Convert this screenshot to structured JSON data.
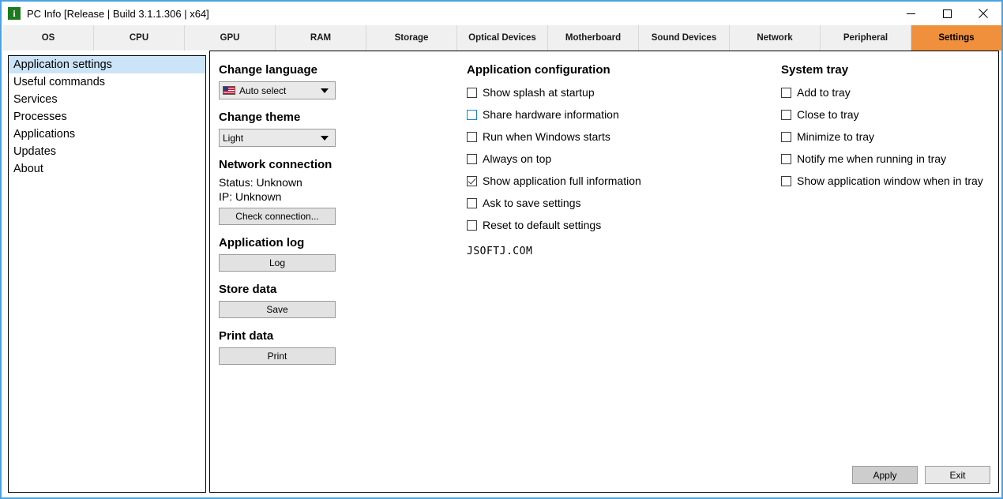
{
  "window": {
    "title": "PC Info [Release | Build 3.1.1.306 | x64]",
    "icon": "info-icon",
    "accent_color": "#f0903c",
    "border_color": "#4aa3e0",
    "controls": {
      "minimize": "minimize-icon",
      "maximize": "maximize-icon",
      "close": "close-icon"
    }
  },
  "tabs": [
    {
      "label": "OS",
      "active": false
    },
    {
      "label": "CPU",
      "active": false
    },
    {
      "label": "GPU",
      "active": false
    },
    {
      "label": "RAM",
      "active": false
    },
    {
      "label": "Storage",
      "active": false
    },
    {
      "label": "Optical Devices",
      "active": false
    },
    {
      "label": "Motherboard",
      "active": false
    },
    {
      "label": "Sound Devices",
      "active": false
    },
    {
      "label": "Network",
      "active": false
    },
    {
      "label": "Peripheral",
      "active": false
    },
    {
      "label": "Settings",
      "active": true
    }
  ],
  "sidebar": {
    "items": [
      {
        "label": "Application settings",
        "selected": true
      },
      {
        "label": "Useful commands",
        "selected": false
      },
      {
        "label": "Services",
        "selected": false
      },
      {
        "label": "Processes",
        "selected": false
      },
      {
        "label": "Applications",
        "selected": false
      },
      {
        "label": "Updates",
        "selected": false
      },
      {
        "label": "About",
        "selected": false
      }
    ]
  },
  "left_column": {
    "language": {
      "heading": "Change language",
      "value": "Auto select",
      "icon": "us-flag-icon"
    },
    "theme": {
      "heading": "Change theme",
      "value": "Light"
    },
    "network": {
      "heading": "Network connection",
      "status": "Status: Unknown",
      "ip": "IP: Unknown",
      "check_button": "Check connection..."
    },
    "app_log": {
      "heading": "Application log",
      "button": "Log"
    },
    "store_data": {
      "heading": "Store data",
      "button": "Save"
    },
    "print_data": {
      "heading": "Print data",
      "button": "Print"
    }
  },
  "app_config": {
    "heading": "Application configuration",
    "options": [
      {
        "label": "Show splash at startup",
        "checked": false,
        "focused": false
      },
      {
        "label": "Share hardware information",
        "checked": false,
        "focused": true
      },
      {
        "label": "Run when Windows starts",
        "checked": false,
        "focused": false
      },
      {
        "label": "Always on top",
        "checked": false,
        "focused": false
      },
      {
        "label": "Show application full information",
        "checked": true,
        "focused": false
      },
      {
        "label": "Ask to save settings",
        "checked": false,
        "focused": false
      },
      {
        "label": "Reset to default settings",
        "checked": false,
        "focused": false
      }
    ],
    "watermark": "JSOFTJ.COM"
  },
  "system_tray": {
    "heading": "System tray",
    "options": [
      {
        "label": "Add to tray",
        "checked": false
      },
      {
        "label": "Close to tray",
        "checked": false
      },
      {
        "label": "Minimize to tray",
        "checked": false
      },
      {
        "label": "Notify me when running in tray",
        "checked": false
      },
      {
        "label": "Show application window when in tray",
        "checked": false
      }
    ]
  },
  "footer": {
    "apply_label": "Apply",
    "exit_label": "Exit"
  }
}
